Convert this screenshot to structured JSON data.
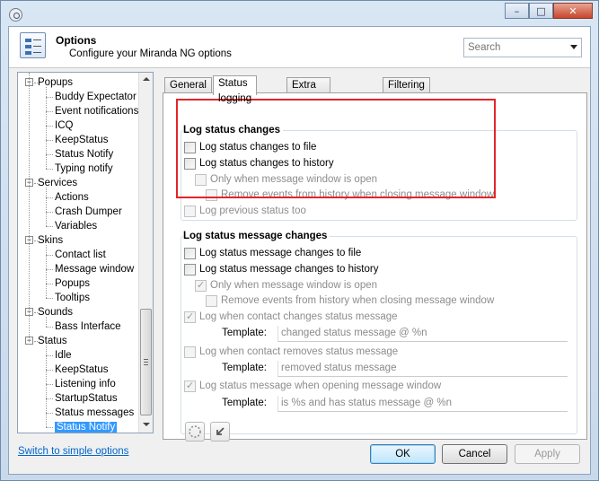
{
  "window": {
    "minimize_glyph": "–",
    "maximize_glyph": "□",
    "close_glyph": "✕"
  },
  "header": {
    "title": "Options",
    "subtitle": "Configure your Miranda NG options",
    "search_placeholder": "Search"
  },
  "tree": [
    {
      "label": "Popups",
      "level": 0,
      "expanded": true
    },
    {
      "label": "Buddy Expectator",
      "level": 1
    },
    {
      "label": "Event notifications",
      "level": 1
    },
    {
      "label": "ICQ",
      "level": 1
    },
    {
      "label": "KeepStatus",
      "level": 1
    },
    {
      "label": "Status Notify",
      "level": 1
    },
    {
      "label": "Typing notify",
      "level": 1
    },
    {
      "label": "Services",
      "level": 0,
      "expanded": true
    },
    {
      "label": "Actions",
      "level": 1
    },
    {
      "label": "Crash Dumper",
      "level": 1
    },
    {
      "label": "Variables",
      "level": 1
    },
    {
      "label": "Skins",
      "level": 0,
      "expanded": true
    },
    {
      "label": "Contact list",
      "level": 1
    },
    {
      "label": "Message window",
      "level": 1
    },
    {
      "label": "Popups",
      "level": 1
    },
    {
      "label": "Tooltips",
      "level": 1
    },
    {
      "label": "Sounds",
      "level": 0,
      "expanded": true
    },
    {
      "label": "Bass Interface",
      "level": 1
    },
    {
      "label": "Status",
      "level": 0,
      "expanded": true
    },
    {
      "label": "Idle",
      "level": 1
    },
    {
      "label": "KeepStatus",
      "level": 1
    },
    {
      "label": "Listening info",
      "level": 1
    },
    {
      "label": "StartupStatus",
      "level": 1
    },
    {
      "label": "Status messages",
      "level": 1
    },
    {
      "label": "Status Notify",
      "level": 1,
      "selected": true
    }
  ],
  "tabs": [
    "General",
    "Status logging",
    "Extra status logging",
    "Filtering"
  ],
  "active_tab": "Status logging",
  "log_status": {
    "title": "Log status changes",
    "to_file": "Log status changes to file",
    "to_history": "Log status changes to history",
    "only_open": "Only when message window is open",
    "remove_events": "Remove events from history when closing message window",
    "previous": "Log previous status too"
  },
  "log_msg": {
    "title": "Log status message changes",
    "to_file": "Log status message changes to file",
    "to_history": "Log status message changes to history",
    "only_open": "Only when message window is open",
    "remove_events": "Remove events from history when closing message window",
    "changes": "Log when contact changes status message",
    "removes": "Log when contact removes status message",
    "opening": "Log status message when opening message window",
    "template_label": "Template:",
    "tpl_changed": "changed status message @ %n",
    "tpl_removed": "removed status message",
    "tpl_opening": "is %s and has status message @ %n"
  },
  "footer": {
    "simple_link": "Switch to simple options",
    "ok": "OK",
    "cancel": "Cancel",
    "apply": "Apply"
  },
  "colors": {
    "highlight": "#e2252a",
    "selection": "#3399ff",
    "link": "#0066cc"
  }
}
